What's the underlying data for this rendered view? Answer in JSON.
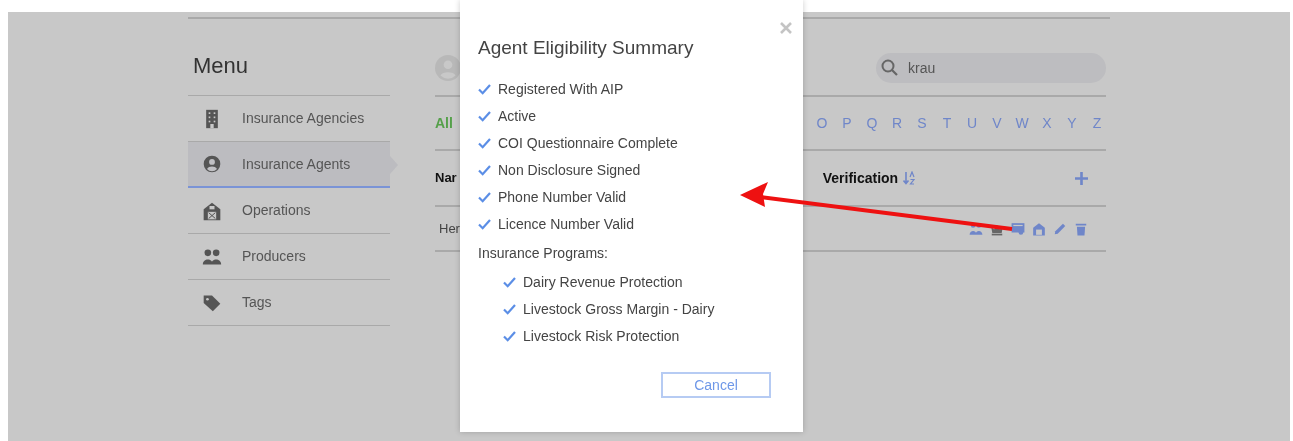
{
  "menu": {
    "title": "Menu",
    "items": [
      {
        "label": "Insurance Agencies",
        "selected": false
      },
      {
        "label": "Insurance Agents",
        "selected": true
      },
      {
        "label": "Operations",
        "selected": false
      },
      {
        "label": "Producers",
        "selected": false
      },
      {
        "label": "Tags",
        "selected": false
      }
    ]
  },
  "search": {
    "value": "krau"
  },
  "letter_filter": [
    {
      "label": "All",
      "selected": true
    },
    {
      "label": "O",
      "selected": false
    },
    {
      "label": "P",
      "selected": false
    },
    {
      "label": "Q",
      "selected": false
    },
    {
      "label": "R",
      "selected": false
    },
    {
      "label": "S",
      "selected": false
    },
    {
      "label": "T",
      "selected": false
    },
    {
      "label": "U",
      "selected": false
    },
    {
      "label": "V",
      "selected": false
    },
    {
      "label": "W",
      "selected": false
    },
    {
      "label": "X",
      "selected": false
    },
    {
      "label": "Y",
      "selected": false
    },
    {
      "label": "Z",
      "selected": false
    }
  ],
  "table": {
    "columns": [
      {
        "label": "Nar"
      },
      {
        "label": "Verification"
      }
    ],
    "rows": [
      {
        "name": "Her"
      }
    ]
  },
  "dialog": {
    "title": "Agent Eligibility Summary",
    "checks": [
      {
        "label": "Registered With AIP",
        "checked": true
      },
      {
        "label": "Active",
        "checked": true
      },
      {
        "label": "COI Questionnaire Complete",
        "checked": true
      },
      {
        "label": "Non Disclosure Signed",
        "checked": true
      },
      {
        "label": "Phone Number Valid",
        "checked": true
      },
      {
        "label": "Licence Number Valid",
        "checked": true
      }
    ],
    "programs_heading": "Insurance Programs:",
    "programs": [
      {
        "label": "Dairy Revenue Protection",
        "checked": true
      },
      {
        "label": "Livestock Gross Margin - Dairy",
        "checked": true
      },
      {
        "label": "Livestock Risk Protection",
        "checked": true
      }
    ],
    "cancel": "Cancel"
  }
}
